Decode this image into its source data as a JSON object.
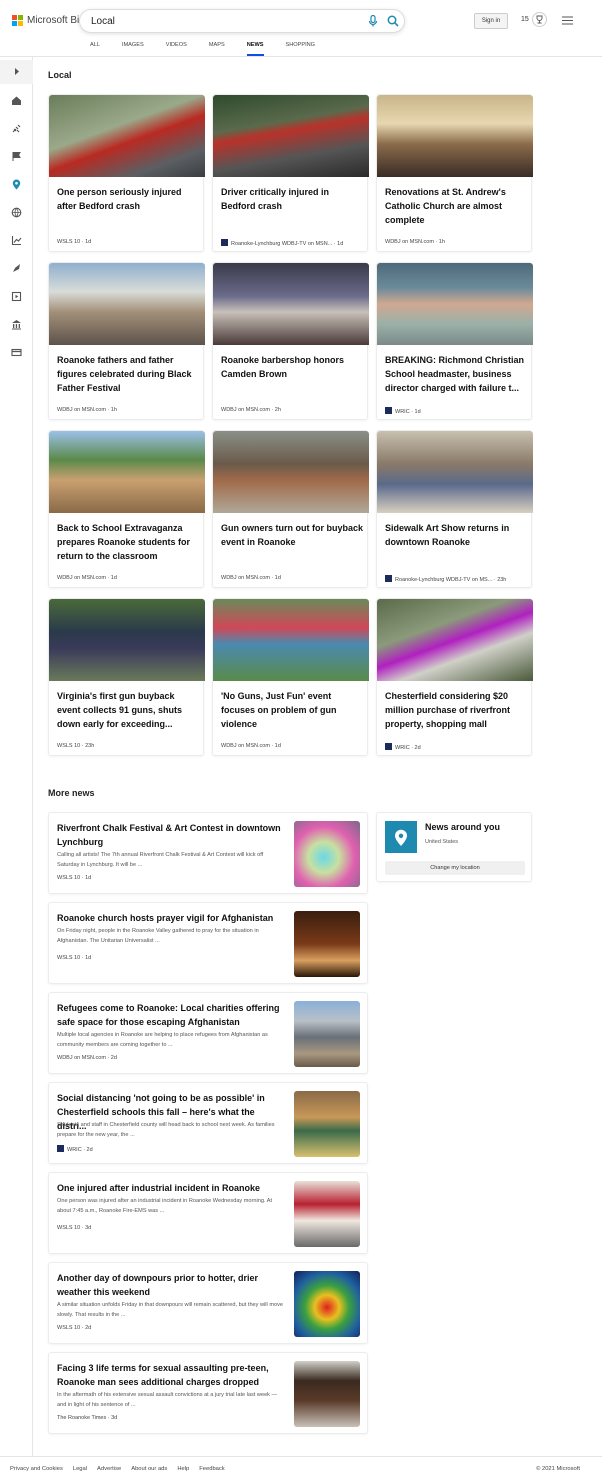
{
  "header": {
    "brand": "Microsoft Bing",
    "query": "Local",
    "signin": "Sign in",
    "points": "15",
    "tabs": [
      "ALL",
      "IMAGES",
      "VIDEOS",
      "MAPS",
      "NEWS",
      "SHOPPING"
    ],
    "active_tab": "NEWS"
  },
  "sidebar_icons": [
    "expand-icon",
    "home-icon",
    "satellite-icon",
    "flag-icon",
    "location-icon",
    "globe-icon",
    "chart-icon",
    "rocket-icon",
    "video-icon",
    "bank-icon",
    "card-icon"
  ],
  "local": {
    "heading": "Local",
    "cards": [
      {
        "title": "One person seriously injured after Bedford crash",
        "source": "WSLS 10 · 1d",
        "logo": false
      },
      {
        "title": "Driver critically injured in Bedford crash",
        "source": "Roanoke-Lynchburg WDBJ-TV on MSN... · 1d",
        "logo": true
      },
      {
        "title": "Renovations at St. Andrew's Catholic Church are almost complete",
        "source": "WDBJ on MSN.com · 1h",
        "logo": false
      },
      {
        "title": "Roanoke fathers and father figures celebrated during Black Father Festival",
        "source": "WDBJ on MSN.com · 1h",
        "logo": false
      },
      {
        "title": "Roanoke barbershop honors Camden Brown",
        "source": "WDBJ on MSN.com · 2h",
        "logo": false
      },
      {
        "title": "BREAKING: Richmond Christian School headmaster, business director charged with failure t...",
        "source": "WRIC · 1d",
        "logo": true
      },
      {
        "title": "Back to School Extravaganza prepares Roanoke students for return to the classroom",
        "source": "WDBJ on MSN.com · 1d",
        "logo": false
      },
      {
        "title": "Gun owners turn out for buyback event in Roanoke",
        "source": "WDBJ on MSN.com · 1d",
        "logo": false
      },
      {
        "title": "Sidewalk Art Show returns in downtown Roanoke",
        "source": "Roanoke-Lynchburg WDBJ-TV on MS... · 23h",
        "logo": true
      },
      {
        "title": "Virginia's first gun buyback event collects 91 guns, shuts down early for exceeding...",
        "source": "WSLS 10 · 23h",
        "logo": false
      },
      {
        "title": "'No Guns, Just Fun' event focuses on problem of gun violence",
        "source": "WDBJ on MSN.com · 1d",
        "logo": false
      },
      {
        "title": "Chesterfield considering $20 million purchase of riverfront property, shopping mall",
        "source": "WRIC · 2d",
        "logo": true
      }
    ]
  },
  "more": {
    "heading": "More news",
    "items": [
      {
        "title": "Riverfront Chalk Festival & Art Contest in downtown Lynchburg",
        "snippet": "Calling all artists! The 7th annual Riverfront Chalk Festival & Art Contest will kick off Saturday in Lynchburg. It will be ...",
        "source": "WSLS 10 · 1d",
        "logo": false
      },
      {
        "title": "Roanoke church hosts prayer vigil for Afghanistan",
        "snippet": "On Friday night, people in the Roanoke Valley gathered to pray for the situation in Afghanistan. The Unitarian Universalist ...",
        "source": "WSLS 10 · 1d",
        "logo": false
      },
      {
        "title": "Refugees come to Roanoke: Local charities offering safe space for those escaping Afghanistan",
        "snippet": "Multiple local agencies in Roanoke are helping to place refugees from Afghanistan as community members are coming together to ...",
        "source": "WDBJ on MSN.com · 2d",
        "logo": false
      },
      {
        "title": "Social distancing 'not going to be as possible' in Chesterfield schools this fall – here's what the distri...",
        "snippet": "Students and staff in Chesterfield county will head back to school next week. As families prepare for the new year, the ...",
        "source": "WRIC · 2d",
        "logo": true
      },
      {
        "title": "One injured after industrial incident in Roanoke",
        "snippet": "One person was injured after an industrial incident in Roanoke Wednesday morning. At about 7:45 a.m., Roanoke Fire-EMS was ...",
        "source": "WSLS 10 · 3d",
        "logo": false
      },
      {
        "title": "Another day of downpours prior to hotter, drier weather this weekend",
        "snippet": "A similar situation unfolds Friday in that downpours will remain scattered, but they will move slowly. That results in the ...",
        "source": "WSLS 10 · 2d",
        "logo": false
      },
      {
        "title": "Facing 3 life terms for sexual assaulting pre-teen, Roanoke man sees additional charges dropped",
        "snippet": "In the aftermath of his extensive sexual assault convictions at a jury trial late last week — and in light of his sentence of ...",
        "source": "The Roanoke Times · 3d",
        "logo": false
      }
    ]
  },
  "around": {
    "title": "News around you",
    "country": "United States",
    "button": "Change my location"
  },
  "footer": {
    "links": [
      "Privacy and Cookies",
      "Legal",
      "Advertise",
      "About our ads",
      "Help",
      "Feedback"
    ],
    "copyright": "© 2021 Microsoft"
  },
  "colors": {
    "accent": "#174ae4",
    "teal": "#1e8ab0"
  }
}
